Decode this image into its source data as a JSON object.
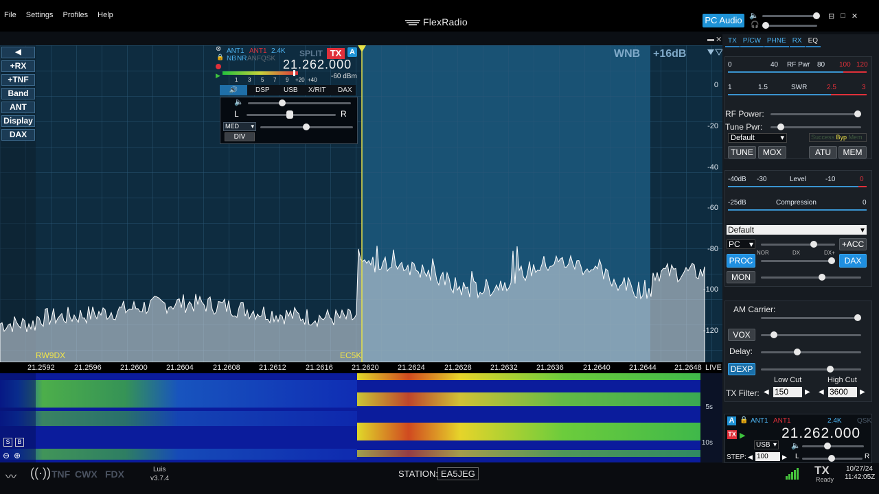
{
  "menu": [
    "File",
    "Settings",
    "Profiles",
    "Help"
  ],
  "brand": "FlexRadio",
  "pc_audio": "PC Audio",
  "window_controls": [
    "⊟",
    "□",
    "✕"
  ],
  "left_buttons": [
    "+RX",
    "+TNF",
    "Band",
    "ANT",
    "Display",
    "DAX"
  ],
  "panadapter": {
    "wnb": "WNB",
    "gain": "+16dB",
    "db_labels": [
      "0",
      "-20",
      "-40",
      "-60",
      "-80",
      "-100",
      "-120"
    ],
    "spots": [
      "RW9DX",
      "EC5K"
    ],
    "freq_labels": [
      "21.2592",
      "21.2596",
      "21.2600",
      "21.2604",
      "21.2608",
      "21.2612",
      "21.2616",
      "21.2620",
      "21.2624",
      "21.2628",
      "21.2632",
      "21.2636",
      "21.2640",
      "21.2644",
      "21.2648"
    ],
    "live": "LIVE",
    "waterfall_times": [
      "5s",
      "10s"
    ]
  },
  "slice": {
    "ant_rx": "ANT1",
    "ant_tx": "ANT1",
    "filter": "2.4K",
    "split": "SPLIT",
    "tx": "TX",
    "letter": "A",
    "dsp_flags": [
      "NB",
      "NR",
      "ANF",
      "QSK"
    ],
    "frequency": "21.262.000",
    "smeter_ticks": [
      "1",
      "3",
      "5",
      "7",
      "9",
      "+20",
      "+40"
    ],
    "smeter_value": "-60 dBm",
    "tabs": [
      "DSP",
      "USB",
      "X/RIT",
      "DAX"
    ],
    "pan_l": "L",
    "pan_r": "R",
    "agc": "MED",
    "div": "DIV"
  },
  "right_tabs": [
    "TX",
    "P/CW",
    "PHNE",
    "RX",
    "EQ"
  ],
  "tx_meters": {
    "rf_scale": [
      "0",
      "40",
      "RF Pwr",
      "80",
      "100",
      "120"
    ],
    "swr_scale": [
      "1",
      "1.5",
      "SWR",
      "2.5",
      "3"
    ]
  },
  "rf_power_label": "RF Power:",
  "tune_pwr_label": "Tune Pwr:",
  "tx_profile": "Default",
  "atu_status": [
    "Success",
    "Byp",
    "Mem"
  ],
  "tx_buttons": [
    "TUNE",
    "MOX",
    "ATU",
    "MEM"
  ],
  "level_meter": [
    "-40dB",
    "-30",
    "Level",
    "-10",
    "0"
  ],
  "comp_meter": [
    "-25dB",
    "Compression",
    "0"
  ],
  "mic_profile": "Default",
  "mic_source": "PC",
  "acc": "+ACC",
  "proc": "PROC",
  "proc_scale": [
    "NOR",
    "DX",
    "DX+"
  ],
  "dax": "DAX",
  "mon": "MON",
  "am_carrier": "AM Carrier:",
  "vox": "VOX",
  "delay_label": "Delay:",
  "dexp": "DEXP",
  "low_cut_label": "Low Cut",
  "high_cut_label": "High Cut",
  "tx_filter_label": "TX Filter:",
  "low_cut": "150",
  "high_cut": "3600",
  "mini_slice": {
    "letter": "A",
    "ant_rx": "ANT1",
    "ant_tx": "ANT1",
    "filter": "2.4K",
    "qsk": "QSK",
    "tx": "TX",
    "frequency": "21.262.000",
    "mode": "USB",
    "step_label": "STEP:",
    "step": "100",
    "l": "L",
    "r": "R"
  },
  "bottom": {
    "icons": [
      "TNF",
      "CWX",
      "FDX"
    ],
    "user": "Luis",
    "version": "v3.7.4",
    "station_label": "STATION:",
    "station": "EA5JEG",
    "tx": "TX",
    "tx_status": "Ready",
    "date": "10/27/24",
    "time": "11:42:05Z"
  }
}
